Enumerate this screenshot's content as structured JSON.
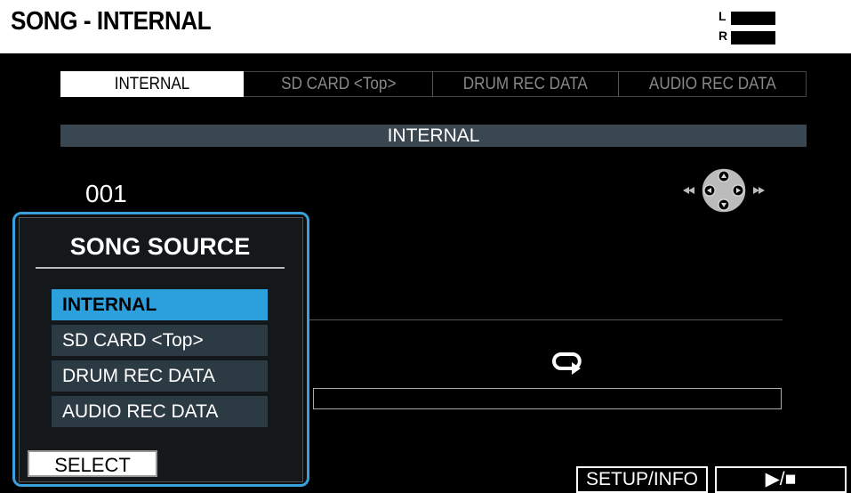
{
  "header": {
    "title": "SONG - INTERNAL",
    "meter_left_label": "L",
    "meter_right_label": "R"
  },
  "tabs": [
    {
      "label": "INTERNAL",
      "active": true
    },
    {
      "label": "SD CARD <Top>",
      "active": false
    },
    {
      "label": "DRUM REC DATA",
      "active": false
    },
    {
      "label": "AUDIO REC DATA",
      "active": false
    }
  ],
  "section": {
    "label": "INTERNAL"
  },
  "song": {
    "number": "001"
  },
  "controls": {
    "dpad_icon": "dpad-icon",
    "loop_icon": "loop-icon"
  },
  "buttons": {
    "setup": "SETUP/INFO",
    "play": "▶/■"
  },
  "popup": {
    "title": "SONG SOURCE",
    "options": [
      "INTERNAL",
      "SD CARD <Top>",
      "DRUM REC DATA",
      "AUDIO REC DATA"
    ],
    "selected": "INTERNAL",
    "select_label": "SELECT"
  },
  "colors": {
    "accent": "#2ca0dc",
    "header_bg": "#ffffff",
    "bg": "#000000"
  }
}
